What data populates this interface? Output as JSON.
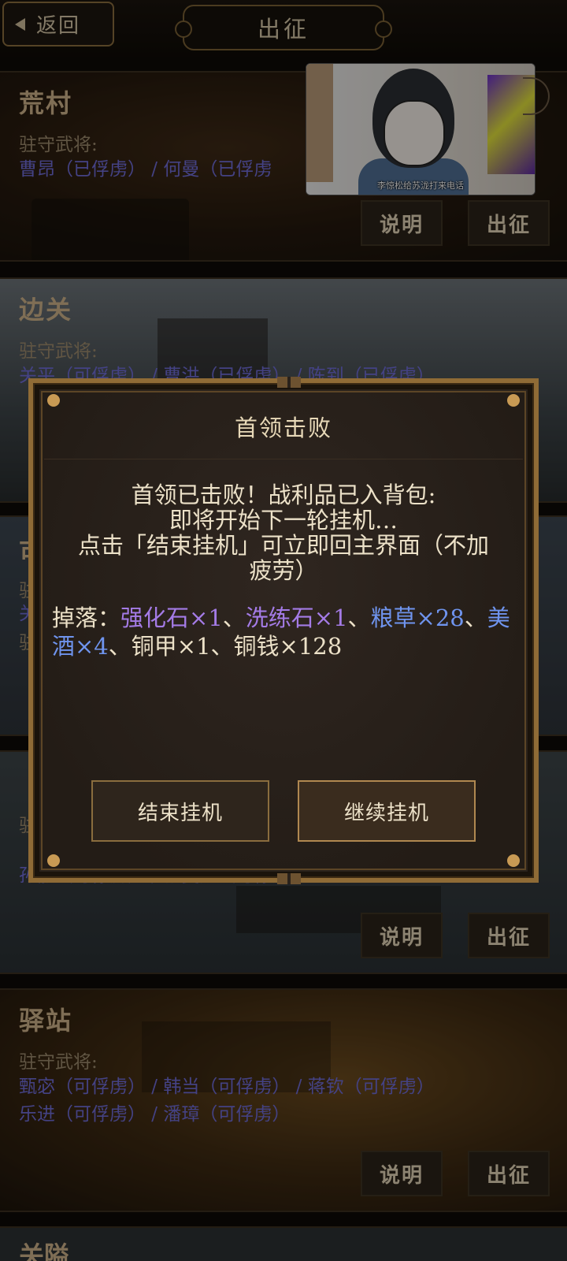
{
  "header": {
    "back_label": "返回",
    "title": "出征"
  },
  "cards": [
    {
      "name": "荒村",
      "guard_label": "驻守武将:",
      "generals": "曹昂（已俘虏） / 何曼（已俘虏",
      "info_label": "说明",
      "go_label": "出征"
    },
    {
      "name": "边关",
      "guard_label": "驻守武将:",
      "generals": "关平（可俘虏） / 曹洪（已俘虏） / 陈到（已俘虏）"
    },
    {
      "name": "可",
      "guard_label": "驻",
      "generals_line1": "关",
      "generals_line2": "驻"
    },
    {
      "name": "",
      "guard_label": "驻",
      "generals_line1": "孙静（可俘虏） / 张曼成（可俘虏）",
      "info_label": "说明",
      "go_label": "出征"
    },
    {
      "name": "驿站",
      "guard_label": "驻守武将:",
      "generals_line1": "甄宓（可俘虏） / 韩当（可俘虏） / 蒋钦（可俘虏）",
      "generals_line2": "乐进（可俘虏） / 潘璋（可俘虏）",
      "info_label": "说明",
      "go_label": "出征"
    },
    {
      "name": "关隘"
    }
  ],
  "video_ad": {
    "caption": "李惊松给苏泷打来电话"
  },
  "dialog": {
    "title": "首领击败",
    "message_line1": "首领已击败！战利品已入背包:",
    "message_line2": "即将开始下一轮挂机…",
    "message_line3": "点击「结束挂机」可立即回主界面（不加",
    "message_line4": "疲劳）",
    "drops_prefix": "掉落：",
    "drop_items": [
      {
        "text": "强化石×1",
        "color": "#a47be6"
      },
      {
        "text": "洗练石×1",
        "color": "#a47be6"
      },
      {
        "text": "粮草×28",
        "color": "#6f94ee"
      },
      {
        "text": "美酒×4",
        "color": "#6f94ee"
      },
      {
        "text": "铜甲×1",
        "color": "#ece1c8"
      },
      {
        "text": "铜钱×128",
        "color": "#ece1c8"
      }
    ],
    "sep": "、",
    "end_button": "结束挂机",
    "continue_button": "继续挂机"
  }
}
